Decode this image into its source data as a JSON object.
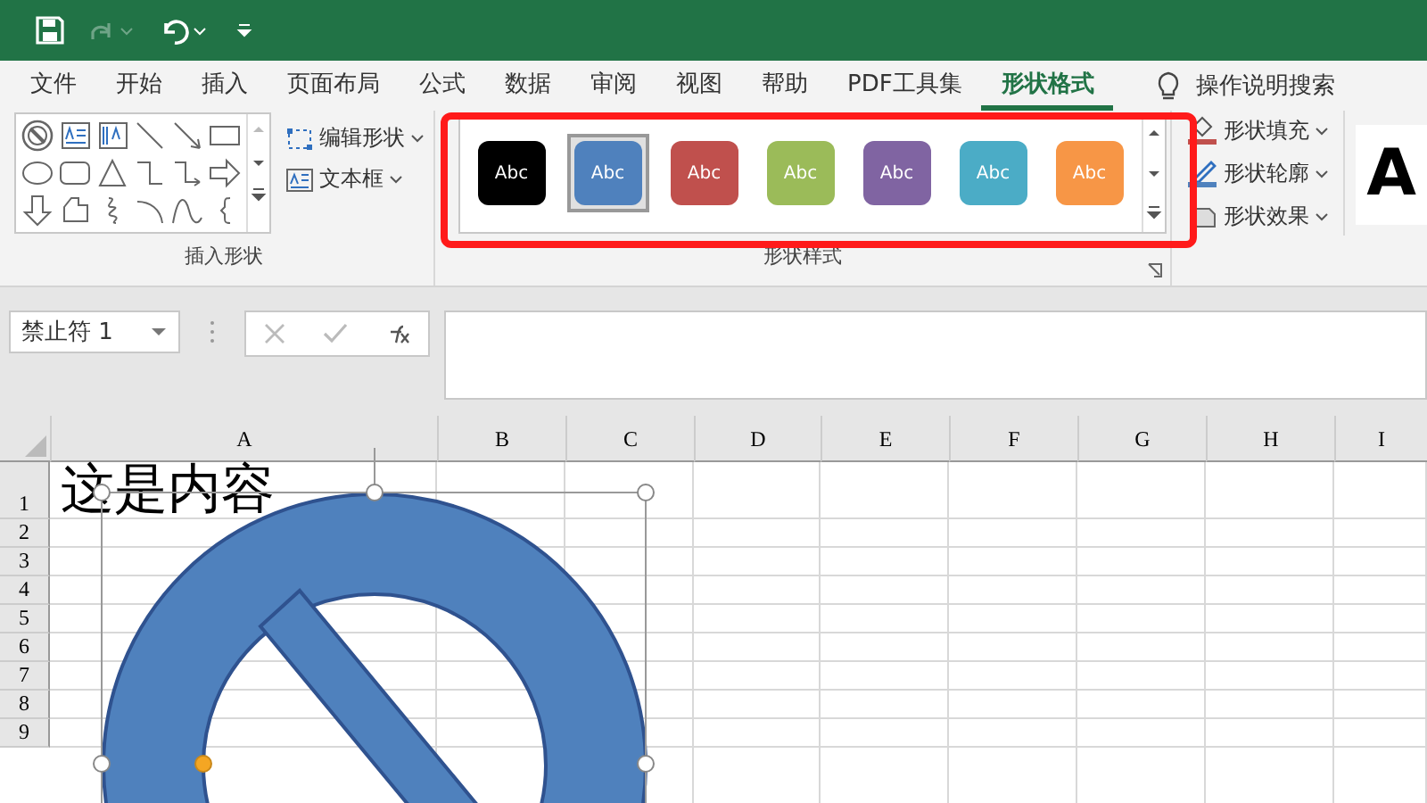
{
  "quick_access": {
    "redo_disabled": true
  },
  "tabs": [
    {
      "label": "文件",
      "selected": false
    },
    {
      "label": "开始",
      "selected": false
    },
    {
      "label": "插入",
      "selected": false
    },
    {
      "label": "页面布局",
      "selected": false
    },
    {
      "label": "公式",
      "selected": false
    },
    {
      "label": "数据",
      "selected": false
    },
    {
      "label": "审阅",
      "selected": false
    },
    {
      "label": "视图",
      "selected": false
    },
    {
      "label": "帮助",
      "selected": false
    },
    {
      "label": "PDF工具集",
      "selected": false
    },
    {
      "label": "形状格式",
      "selected": true
    }
  ],
  "tell_me": "操作说明搜索",
  "insert_shapes": {
    "buttons": [
      "编辑形状",
      "文本框"
    ],
    "label": "插入形状"
  },
  "shape_styles": {
    "swatches": [
      {
        "label": "Abc",
        "color": "#000000",
        "selected": false
      },
      {
        "label": "Abc",
        "color": "#4f81bd",
        "selected": true
      },
      {
        "label": "Abc",
        "color": "#c0504d",
        "selected": false
      },
      {
        "label": "Abc",
        "color": "#9bbb59",
        "selected": false
      },
      {
        "label": "Abc",
        "color": "#8064a2",
        "selected": false
      },
      {
        "label": "Abc",
        "color": "#4bacc6",
        "selected": false
      },
      {
        "label": "Abc",
        "color": "#f79646",
        "selected": false
      }
    ],
    "label": "形状样式"
  },
  "shape_options": [
    "形状填充",
    "形状轮廓",
    "形状效果"
  ],
  "wordart_preview": "A",
  "name_box": "禁止符 1",
  "columns": [
    "A",
    "B",
    "C",
    "D",
    "E",
    "F",
    "G",
    "H",
    "I"
  ],
  "rows": [
    "1",
    "2",
    "3",
    "4",
    "5",
    "6",
    "7",
    "8",
    "9"
  ],
  "cell_a1": "这是内容",
  "shape": {
    "selected": true
  }
}
